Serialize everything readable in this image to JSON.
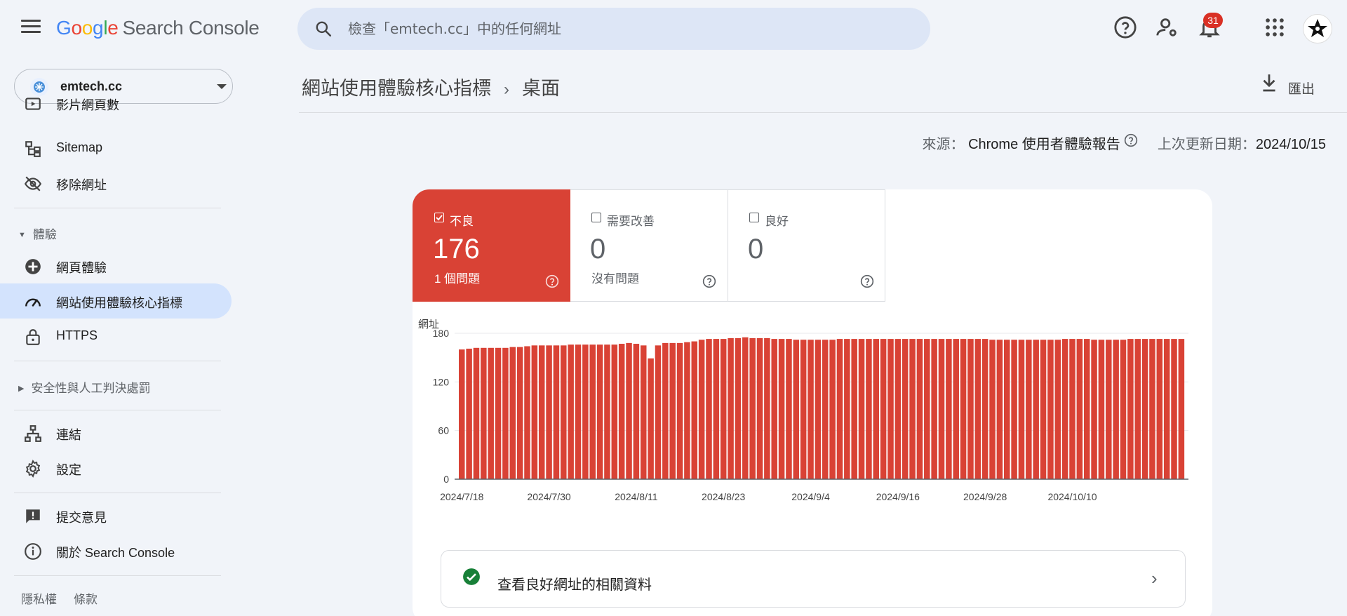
{
  "app": {
    "logo_google": [
      "G",
      "o",
      "o",
      "g",
      "l",
      "e"
    ],
    "logo_product": "Search Console"
  },
  "search": {
    "placeholder": "檢查「emtech.cc」中的任何網址"
  },
  "notifications": {
    "count": "31"
  },
  "property": {
    "name": "emtech.cc"
  },
  "sidebar": {
    "items_top": [
      {
        "label": "影片網頁數",
        "icon": "video-icon"
      },
      {
        "label": "Sitemap",
        "icon": "sitemap-icon"
      },
      {
        "label": "移除網址",
        "icon": "eye-off-icon"
      }
    ],
    "group_experience": "體驗",
    "items_experience": [
      {
        "label": "網頁體驗",
        "icon": "page-experience-icon"
      },
      {
        "label": "網站使用體驗核心指標",
        "icon": "gauge-icon",
        "active": true
      },
      {
        "label": "HTTPS",
        "icon": "lock-icon"
      }
    ],
    "group_security": "安全性與人工判決處罰",
    "items_bottom": [
      {
        "label": "連結",
        "icon": "links-icon"
      },
      {
        "label": "設定",
        "icon": "gear-icon"
      }
    ],
    "items_help": [
      {
        "label": "提交意見",
        "icon": "feedback-icon"
      },
      {
        "label": "關於 Search Console",
        "icon": "info-icon"
      }
    ],
    "footer": [
      "隱私權",
      "條款"
    ]
  },
  "page": {
    "breadcrumb_parent": "網站使用體驗核心指標",
    "breadcrumb_current": "桌面",
    "export_label": "匯出",
    "source_label": "來源：",
    "source_value": "Chrome 使用者體驗報告",
    "updated_label": "上次更新日期：",
    "updated_value": "2024/10/15"
  },
  "tiles": [
    {
      "label": "不良",
      "count": "176",
      "sub": "1 個問題",
      "checked": true
    },
    {
      "label": "需要改善",
      "count": "0",
      "sub": "沒有問題",
      "checked": false
    },
    {
      "label": "良好",
      "count": "0",
      "sub": "",
      "checked": false
    }
  ],
  "good_urls_link": "查看良好網址的相關資料",
  "colors": {
    "poor": "#d94235",
    "good": "#188038",
    "active_bg": "#d3e3fd"
  },
  "chart_data": {
    "type": "bar",
    "ylabel": "網址",
    "ylim": [
      0,
      180
    ],
    "yticks": [
      0,
      60,
      120,
      180
    ],
    "xtick_labels": [
      "2024/7/18",
      "2024/7/30",
      "2024/8/11",
      "2024/8/23",
      "2024/9/4",
      "2024/9/16",
      "2024/9/28",
      "2024/10/10"
    ],
    "start_date": "2024/7/18",
    "series": [
      {
        "values": [
          160,
          161,
          162,
          162,
          162,
          162,
          162,
          163,
          163,
          164,
          165,
          165,
          165,
          165,
          165,
          166,
          166,
          166,
          166,
          166,
          166,
          166,
          167,
          168,
          167,
          165,
          149,
          165,
          168,
          168,
          168,
          169,
          170,
          172,
          173,
          173,
          173,
          174,
          174,
          175,
          174,
          174,
          174,
          173,
          173,
          173,
          172,
          172,
          172,
          172,
          172,
          172,
          173,
          173,
          173,
          173,
          173,
          173,
          173,
          173,
          173,
          173,
          173,
          173,
          173,
          173,
          173,
          173,
          173,
          173,
          173,
          173,
          173,
          172,
          172,
          172,
          172,
          172,
          172,
          172,
          172,
          172,
          172,
          173,
          173,
          173,
          173,
          172,
          172,
          172,
          172,
          172,
          173,
          173,
          173,
          173,
          173,
          173,
          173,
          173
        ]
      }
    ]
  }
}
